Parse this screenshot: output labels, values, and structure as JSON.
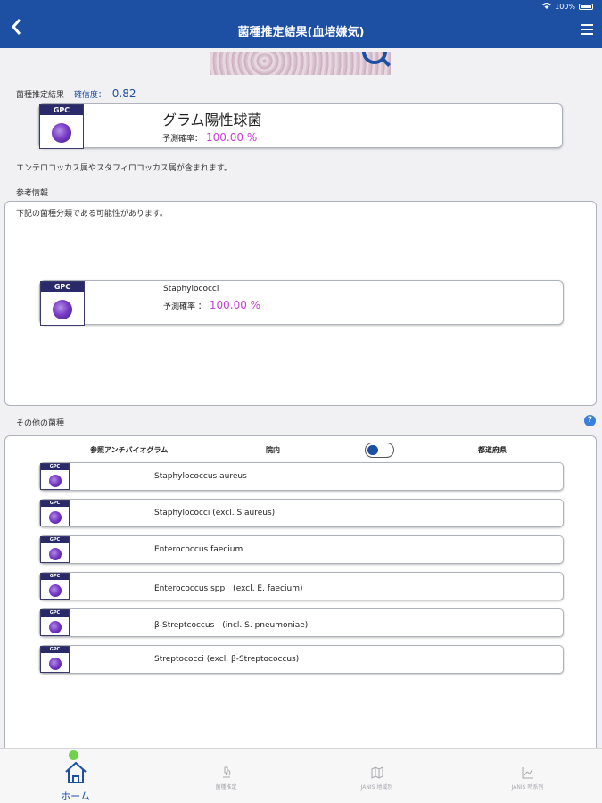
{
  "statusbar": {
    "battery": "100%"
  },
  "nav": {
    "title": "菌種推定結果(血培嫌気)"
  },
  "result": {
    "label": "菌種推定結果",
    "confidence_label": "確信度：",
    "confidence_value": "0.82",
    "main": {
      "badge": "GPC",
      "name": "グラム陽性球菌",
      "prob_label": "予測確率：",
      "prob_value": "100.00 %"
    },
    "description": "エンテロコッカス属やスタフィロコッカス属が含まれます。"
  },
  "reference": {
    "title": "参考情報",
    "intro": "下記の菌種分類である可能性があります。",
    "card": {
      "badge": "GPC",
      "name": "Staphylococci",
      "prob_label": "予測確率 ：",
      "prob_value": "100.00 %"
    }
  },
  "others": {
    "title": "その他の菌種",
    "help": "?",
    "antibiogram_label": "参照アンチバイオグラム",
    "in_hospital": "院内",
    "prefecture": "都道府県",
    "items": [
      {
        "badge": "GPC",
        "name": "Staphylococcus aureus"
      },
      {
        "badge": "GPC",
        "name": "Staphylococci (excl. S.aureus)"
      },
      {
        "badge": "GPC",
        "name": "Enterococcus faecium"
      },
      {
        "badge": "GPC",
        "name": "Enterococcus spp　(excl. E. faecium)"
      },
      {
        "badge": "GPC",
        "name": "β-Streptcoccus　(incl. S. pneumoniae)"
      },
      {
        "badge": "GPC",
        "name": "Streptococci (excl. β-Streptococcus)"
      }
    ]
  },
  "tabs": [
    {
      "label": "ホーム",
      "icon": "home-icon"
    },
    {
      "label": "菌種推定",
      "icon": "microscope-icon"
    },
    {
      "label": "JANIS 地域別",
      "icon": "map-icon"
    },
    {
      "label": "JANIS 時系列",
      "icon": "line-chart-icon"
    }
  ],
  "colors": {
    "primary": "#1d4fa3",
    "probability": "#c43ed4",
    "badge": "#2a2a6b",
    "notification": "#6fd34a"
  }
}
